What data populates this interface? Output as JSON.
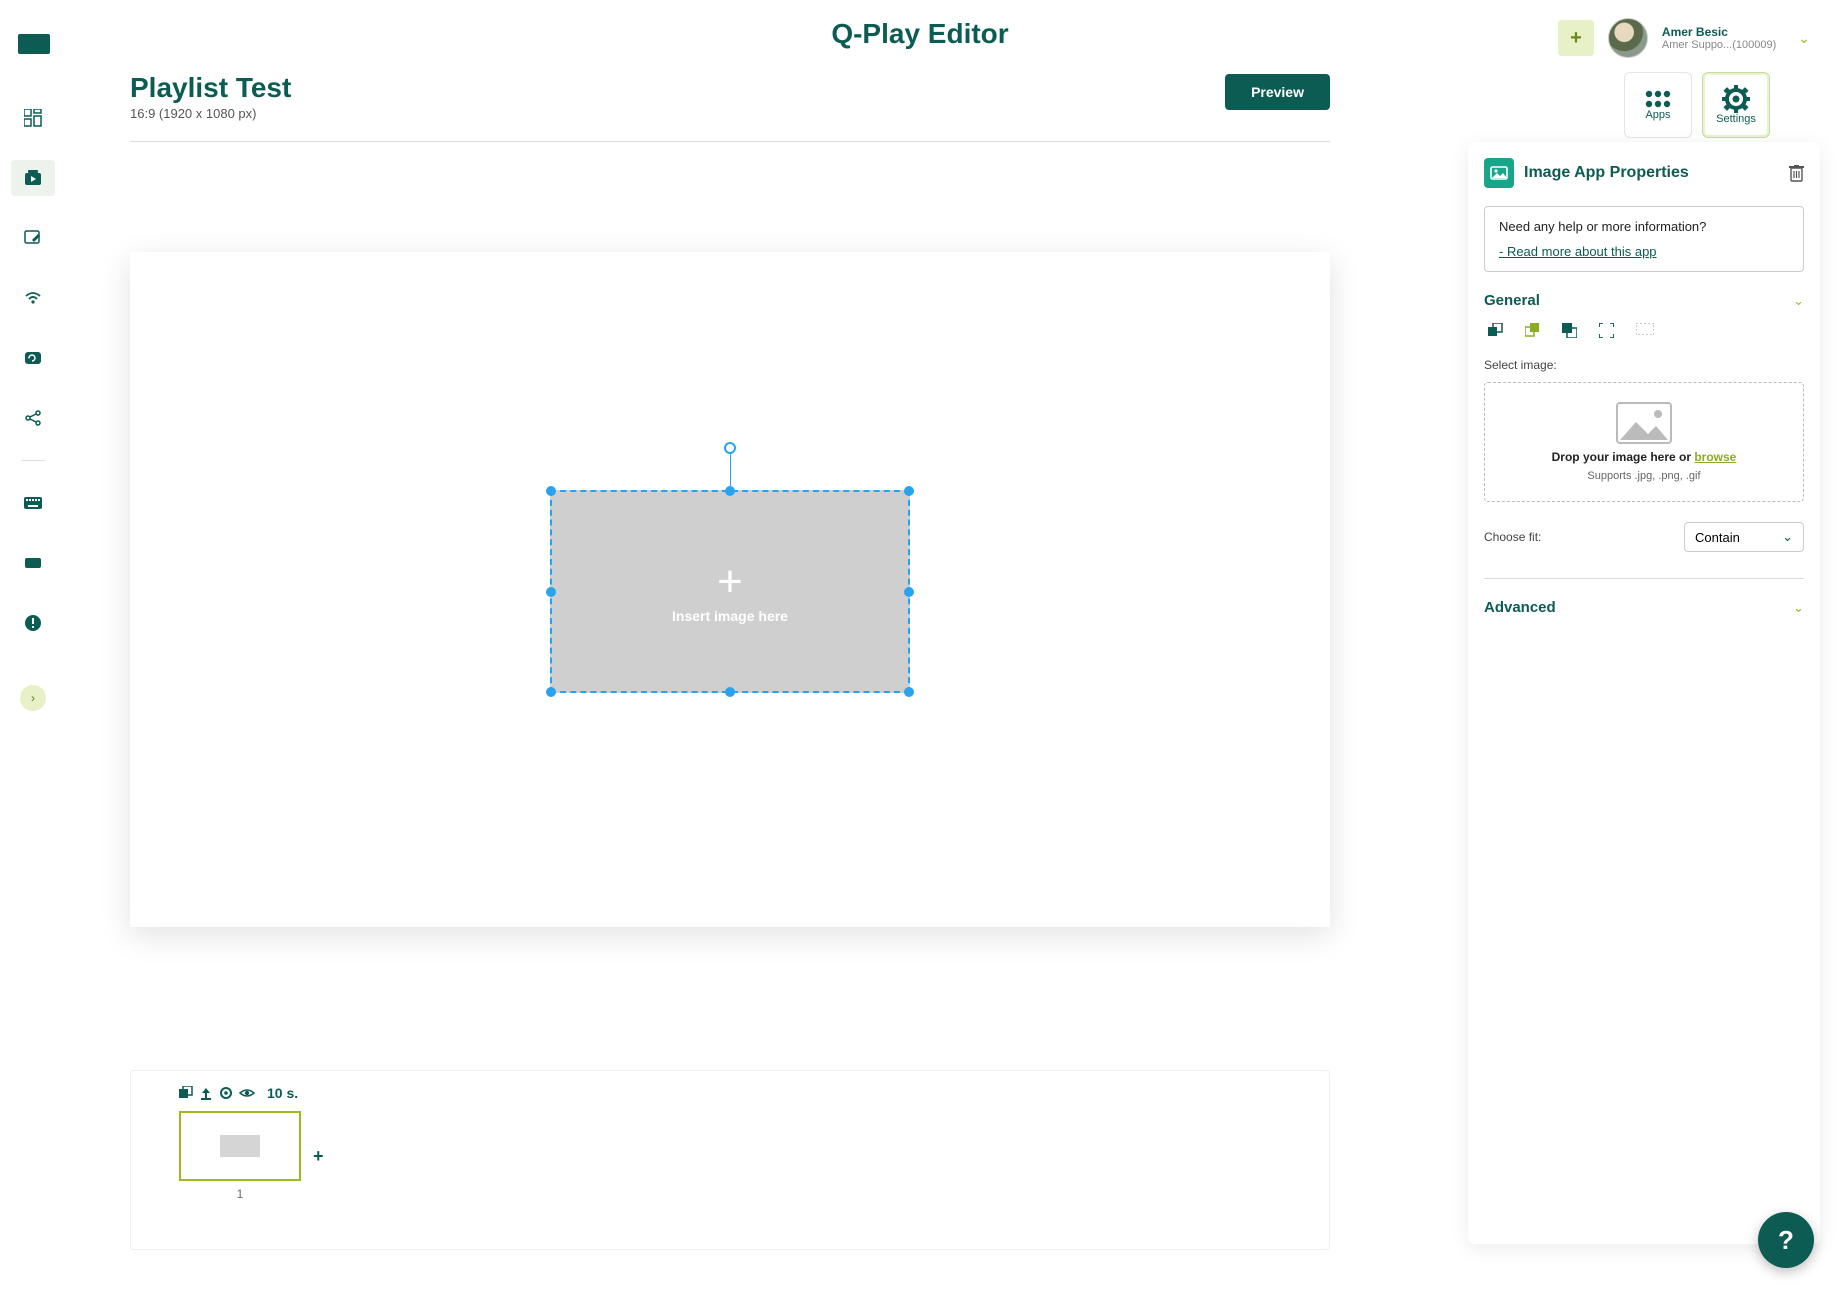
{
  "app": {
    "title": "Q-Play Editor"
  },
  "user": {
    "name": "Amer Besic",
    "org": "Amer Suppo...(100009)"
  },
  "page": {
    "title": "Playlist Test",
    "subtitle": "16:9 (1920 x 1080 px)",
    "preview_label": "Preview"
  },
  "right_tabs": {
    "apps": "Apps",
    "settings": "Settings"
  },
  "panel": {
    "title": "Image App Properties",
    "help": {
      "question": "Need any help or more information?",
      "link": "- Read more about this app"
    },
    "sections": {
      "general": "General",
      "advanced": "Advanced"
    },
    "select_image_label": "Select image:",
    "dropzone": {
      "main_prefix": "Drop your image here or ",
      "browse": "browse",
      "sub": "Supports .jpg, .png, .gif"
    },
    "fit": {
      "label": "Choose fit:",
      "value": "Contain"
    }
  },
  "canvas": {
    "placeholder": "Insert image here"
  },
  "timeline": {
    "duration": "10 s.",
    "slide_num": "1"
  },
  "fab": "?"
}
